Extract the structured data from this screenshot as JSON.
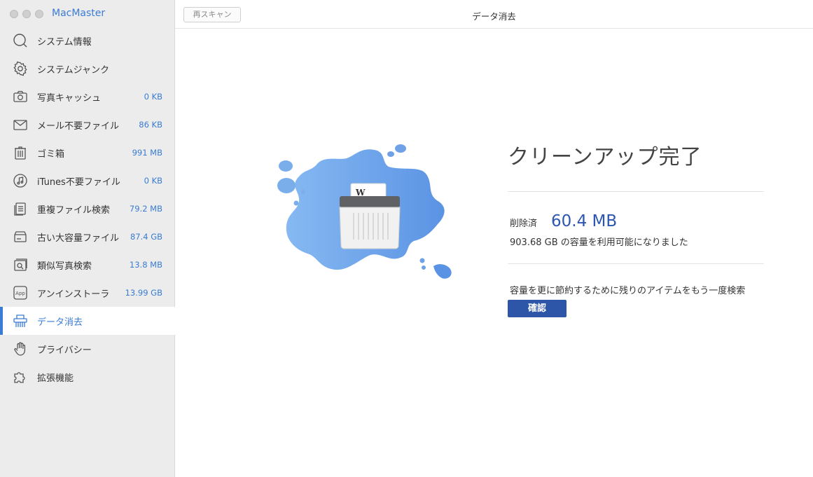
{
  "app": {
    "name": "MacMaster"
  },
  "toolbar": {
    "rescan_label": "再スキャン",
    "page_title": "データ消去"
  },
  "sidebar": {
    "items": [
      {
        "label": "システム情報",
        "size": "",
        "icon": "magnifier-icon"
      },
      {
        "label": "システムジャンク",
        "size": "",
        "icon": "gear-icon"
      },
      {
        "label": "写真キャッシュ",
        "size": "0 KB",
        "icon": "camera-icon"
      },
      {
        "label": "メール不要ファイル",
        "size": "86 KB",
        "icon": "mail-icon"
      },
      {
        "label": "ゴミ箱",
        "size": "991 MB",
        "icon": "trash-icon"
      },
      {
        "label": "iTunes不要ファイル",
        "size": "0 KB",
        "icon": "music-icon"
      },
      {
        "label": "重複ファイル検索",
        "size": "79.2 MB",
        "icon": "duplicate-icon"
      },
      {
        "label": "古い大容量ファイル",
        "size": "87.4 GB",
        "icon": "drive-icon"
      },
      {
        "label": "類似写真検索",
        "size": "13.8 MB",
        "icon": "photo-icon"
      },
      {
        "label": "アンインストーラ",
        "size": "13.99 GB",
        "icon": "app-icon"
      },
      {
        "label": "データ消去",
        "size": "",
        "icon": "shredder-icon"
      },
      {
        "label": "プライバシー",
        "size": "",
        "icon": "hand-icon"
      },
      {
        "label": "拡張機能",
        "size": "",
        "icon": "puzzle-icon"
      }
    ],
    "active_index": 10
  },
  "result": {
    "title": "クリーンアップ完了",
    "deleted_label": "削除済",
    "deleted_value": "60.4 MB",
    "free_text": "903.68 GB の容量を利用可能になりました",
    "hint": "容量を更に節約するために残りのアイテムをもう一度検索",
    "confirm_label": "確認"
  },
  "colors": {
    "accent": "#3a7bd5",
    "button": "#2d56a8",
    "splash": "#6fa6ec"
  }
}
